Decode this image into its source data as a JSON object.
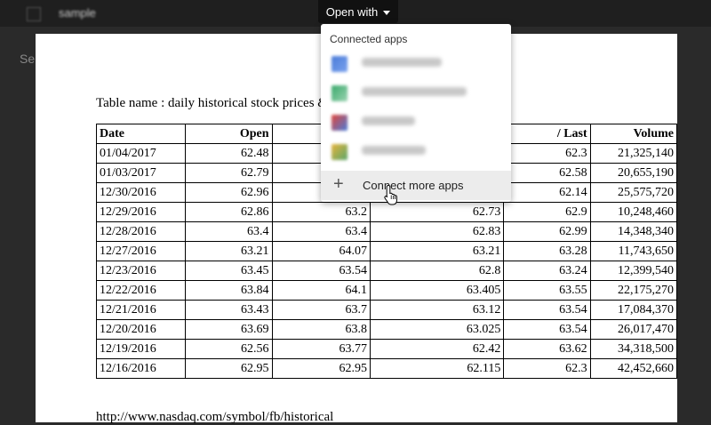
{
  "topbar": {
    "filename": "sample",
    "open_with_label": "Open with"
  },
  "left_strip_text": "Se",
  "document": {
    "title": "Table name : daily historical stock prices &",
    "columns": [
      "Date",
      "Open",
      "",
      "",
      "/ Last",
      "Volume"
    ],
    "rows": [
      [
        "01/04/2017",
        "62.48",
        "",
        "",
        "62.3",
        "21,325,140"
      ],
      [
        "01/03/2017",
        "62.79",
        "",
        "",
        "62.58",
        "20,655,190"
      ],
      [
        "12/30/2016",
        "62.96",
        "",
        "",
        "62.14",
        "25,575,720"
      ],
      [
        "12/29/2016",
        "62.86",
        "63.2",
        "62.73",
        "62.9",
        "10,248,460"
      ],
      [
        "12/28/2016",
        "63.4",
        "63.4",
        "62.83",
        "62.99",
        "14,348,340"
      ],
      [
        "12/27/2016",
        "63.21",
        "64.07",
        "63.21",
        "63.28",
        "11,743,650"
      ],
      [
        "12/23/2016",
        "63.45",
        "63.54",
        "62.8",
        "63.24",
        "12,399,540"
      ],
      [
        "12/22/2016",
        "63.84",
        "64.1",
        "63.405",
        "63.55",
        "22,175,270"
      ],
      [
        "12/21/2016",
        "63.43",
        "63.7",
        "63.12",
        "63.54",
        "17,084,370"
      ],
      [
        "12/20/2016",
        "63.69",
        "63.8",
        "63.025",
        "63.54",
        "26,017,470"
      ],
      [
        "12/19/2016",
        "62.56",
        "63.77",
        "62.42",
        "63.62",
        "34,318,500"
      ],
      [
        "12/16/2016",
        "62.95",
        "62.95",
        "62.115",
        "62.3",
        "42,452,660"
      ]
    ],
    "footer_link": "http://www.nasdaq.com/symbol/fb/historical"
  },
  "menu": {
    "heading": "Connected apps",
    "apps": [
      {
        "icon": "blue-app-icon",
        "colors": [
          "#4a7bd8",
          "#7aa2ee"
        ]
      },
      {
        "icon": "green-app-icon",
        "colors": [
          "#3aa96b",
          "#9ad3b2"
        ]
      },
      {
        "icon": "multicolor-app-icon",
        "colors": [
          "#e0453a",
          "#4a7bd8"
        ]
      },
      {
        "icon": "yellow-app-icon",
        "colors": [
          "#e6b33a",
          "#5aa66a"
        ]
      }
    ],
    "connect_more_label": "Connect more apps"
  }
}
